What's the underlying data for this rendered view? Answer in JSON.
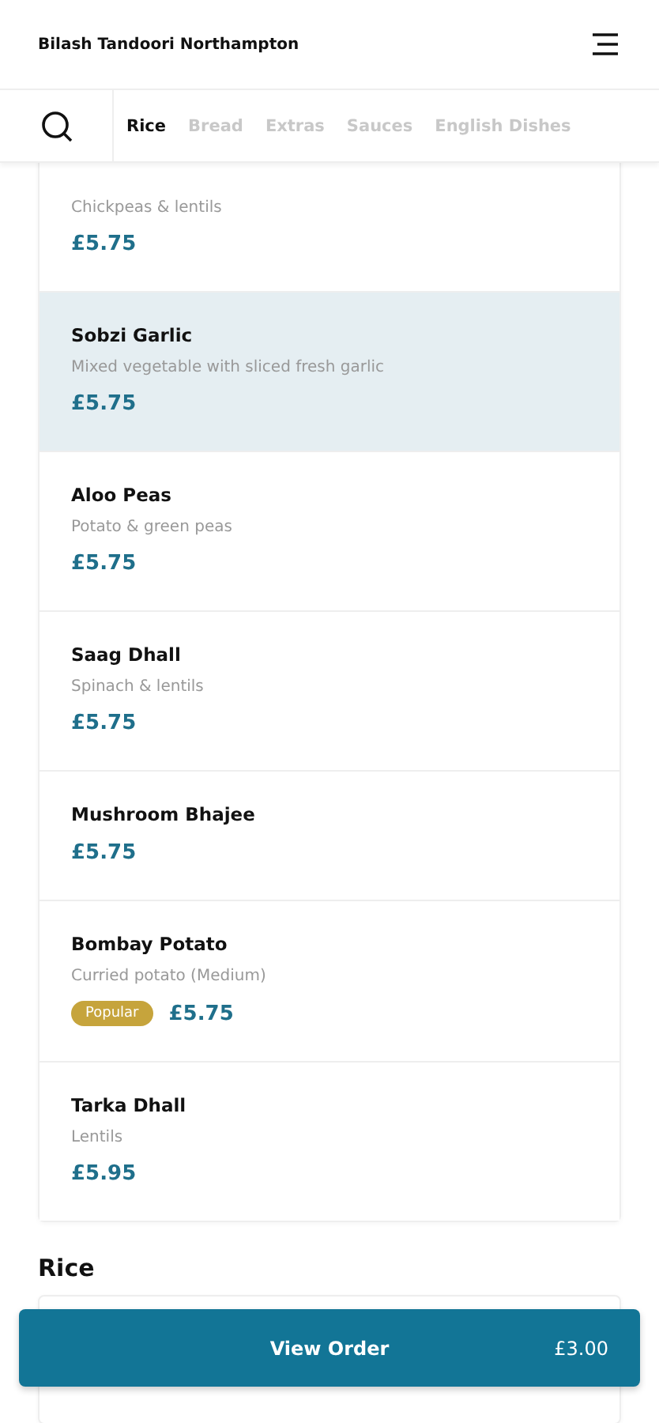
{
  "header": {
    "title": "Bilash Tandoori Northampton"
  },
  "tabs": [
    {
      "label": "Rice",
      "selected": true
    },
    {
      "label": "Bread",
      "selected": false
    },
    {
      "label": "Extras",
      "selected": false
    },
    {
      "label": "Sauces",
      "selected": false
    },
    {
      "label": "English Dishes",
      "selected": false
    }
  ],
  "sections": [
    {
      "items": [
        {
          "description": "Chickpeas & lentils",
          "price": "£5.75",
          "selected": false
        },
        {
          "name": "Sobzi Garlic",
          "description": "Mixed vegetable with sliced fresh garlic",
          "price": "£5.75",
          "selected": true
        },
        {
          "name": "Aloo Peas",
          "description": "Potato & green peas",
          "price": "£5.75",
          "selected": false
        },
        {
          "name": "Saag Dhall",
          "description": "Spinach & lentils",
          "price": "£5.75",
          "selected": false
        },
        {
          "name": "Mushroom Bhajee",
          "price": "£5.75",
          "selected": false
        },
        {
          "name": "Bombay Potato",
          "description": "Curried potato (Medium)",
          "badge": "Popular",
          "price": "£5.75",
          "selected": false
        },
        {
          "name": "Tarka Dhall",
          "description": "Lentils",
          "price": "£5.95",
          "selected": false
        }
      ]
    },
    {
      "title": "Rice"
    }
  ],
  "order_button": {
    "label": "View Order",
    "total": "£3.00"
  }
}
